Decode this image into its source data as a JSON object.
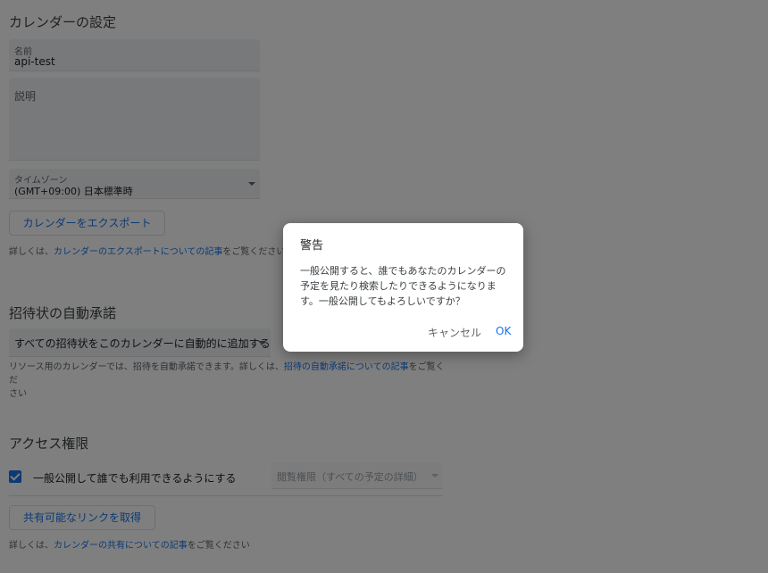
{
  "calendar_settings": {
    "title": "カレンダーの設定",
    "name_label": "名前",
    "name_value": "api-test",
    "description_label": "説明",
    "timezone_label": "タイムゾーン",
    "timezone_value": "(GMT+09:00) 日本標準時",
    "export_button": "カレンダーをエクスポート",
    "export_help_prefix": "詳しくは、",
    "export_help_link": "カレンダーのエクスポートについての記事",
    "export_help_suffix": "をご覧ください"
  },
  "auto_accept": {
    "title": "招待状の自動承諾",
    "select_value": "すべての招待状をこのカレンダーに自動的に追加する",
    "help_prefix": "リソース用のカレンダーでは、招待を自動承諾できます。詳しくは、",
    "help_link": "招待の自動承諾についての記事",
    "help_suffix": "をご覧くだ",
    "help_suffix2": "さい"
  },
  "access": {
    "title": "アクセス権限",
    "public_checkbox_label": "一般公開して誰でも利用できるようにする",
    "public_checked": true,
    "permission_select": "閲覧権限（すべての予定の詳細）",
    "share_link_button": "共有可能なリンクを取得",
    "help_prefix": "詳しくは、",
    "help_link": "カレンダーの共有についての記事",
    "help_suffix": "をご覧ください"
  },
  "dialog": {
    "title": "警告",
    "body": "一般公開すると、誰でもあなたのカレンダーの予定を見たり検索したりできるようになります。一般公開してもよろしいですか？",
    "cancel": "キャンセル",
    "ok": "OK"
  },
  "colors": {
    "accent": "#1a73e8",
    "overlay": "rgba(0,0,0,0.5)",
    "field_bg": "#f1f3f4"
  }
}
